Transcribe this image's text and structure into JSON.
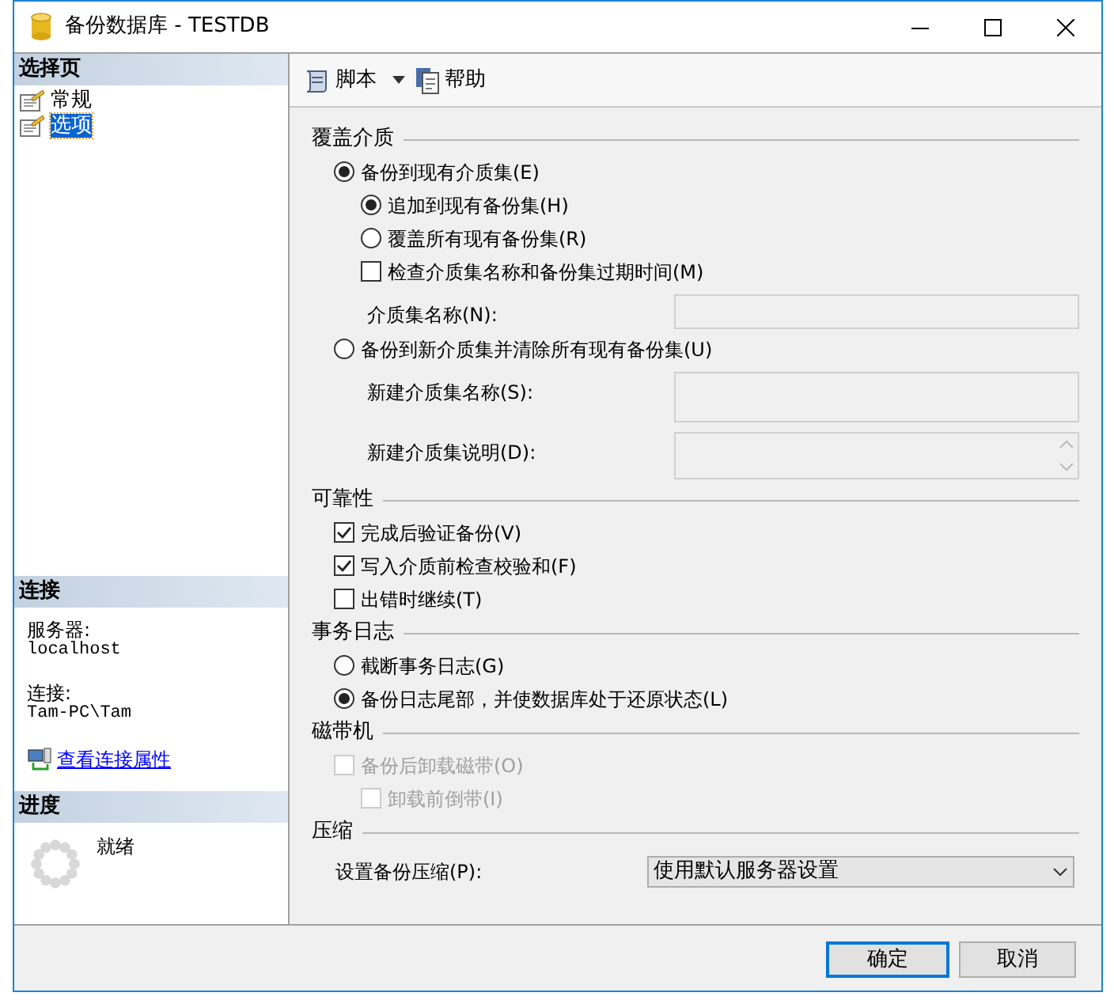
{
  "window": {
    "title": "备份数据库 - TESTDB"
  },
  "sidebar": {
    "title": "选择页",
    "pages": [
      {
        "label": "常规",
        "selected": false
      },
      {
        "label": "选项",
        "selected": true
      }
    ]
  },
  "connection": {
    "title": "连接",
    "server_label": "服务器:",
    "server": "localhost",
    "connection_label": "连接:",
    "connection": "Tam-PC\\Tam",
    "link": "查看连接属性"
  },
  "progress": {
    "title": "进度",
    "status": "就绪"
  },
  "toolbar": [
    {
      "kind": "script",
      "label": "脚本"
    },
    {
      "kind": "help",
      "label": "帮助"
    }
  ],
  "sections": [
    {
      "title": "覆盖介质",
      "items": [
        {
          "kind": "radio",
          "label": "备份到现有介质集(E)",
          "selected": true,
          "children": [
            {
              "kind": "radio",
              "label": "追加到现有备份集(H)",
              "selected": true
            },
            {
              "kind": "radio",
              "label": "覆盖所有现有备份集(R)",
              "selected": false
            },
            {
              "kind": "checkbox",
              "label": "检查介质集名称和备份集过期时间(M)",
              "checked": false
            },
            {
              "kind": "field",
              "label": "介质集名称(N):"
            }
          ]
        },
        {
          "kind": "radio",
          "label": "备份到新介质集并清除所有现有备份集(U)",
          "selected": false,
          "children": [
            {
              "kind": "textbox",
              "label": "新建介质集名称(S):"
            },
            {
              "kind": "memo",
              "label": "新建介质集说明(D):"
            }
          ]
        }
      ]
    },
    {
      "title": "可靠性",
      "items": [
        {
          "kind": "checkbox",
          "label": "完成后验证备份(V)",
          "checked": true
        },
        {
          "kind": "checkbox",
          "label": "写入介质前检查校验和(F)",
          "checked": true
        },
        {
          "kind": "checkbox",
          "label": "出错时继续(T)",
          "checked": false
        }
      ]
    },
    {
      "title": "事务日志",
      "items": [
        {
          "kind": "radio",
          "label": "截断事务日志(G)",
          "selected": false
        },
        {
          "kind": "radio",
          "label": "备份日志尾部，并使数据库处于还原状态(L)",
          "selected": true
        }
      ]
    },
    {
      "title": "磁带机",
      "items": [
        {
          "kind": "checkbox",
          "label": "备份后卸载磁带(O)",
          "checked": false,
          "disabled": true,
          "children": [
            {
              "kind": "checkbox",
              "label": "卸载前倒带(I)",
              "checked": false,
              "disabled": true
            }
          ]
        }
      ]
    },
    {
      "title": "压缩",
      "items": [
        {
          "kind": "select",
          "label": "设置备份压缩(P):",
          "value": "使用默认服务器设置"
        }
      ]
    }
  ],
  "buttons": [
    {
      "label": "确定",
      "default": true
    },
    {
      "label": "取消",
      "default": false
    }
  ]
}
